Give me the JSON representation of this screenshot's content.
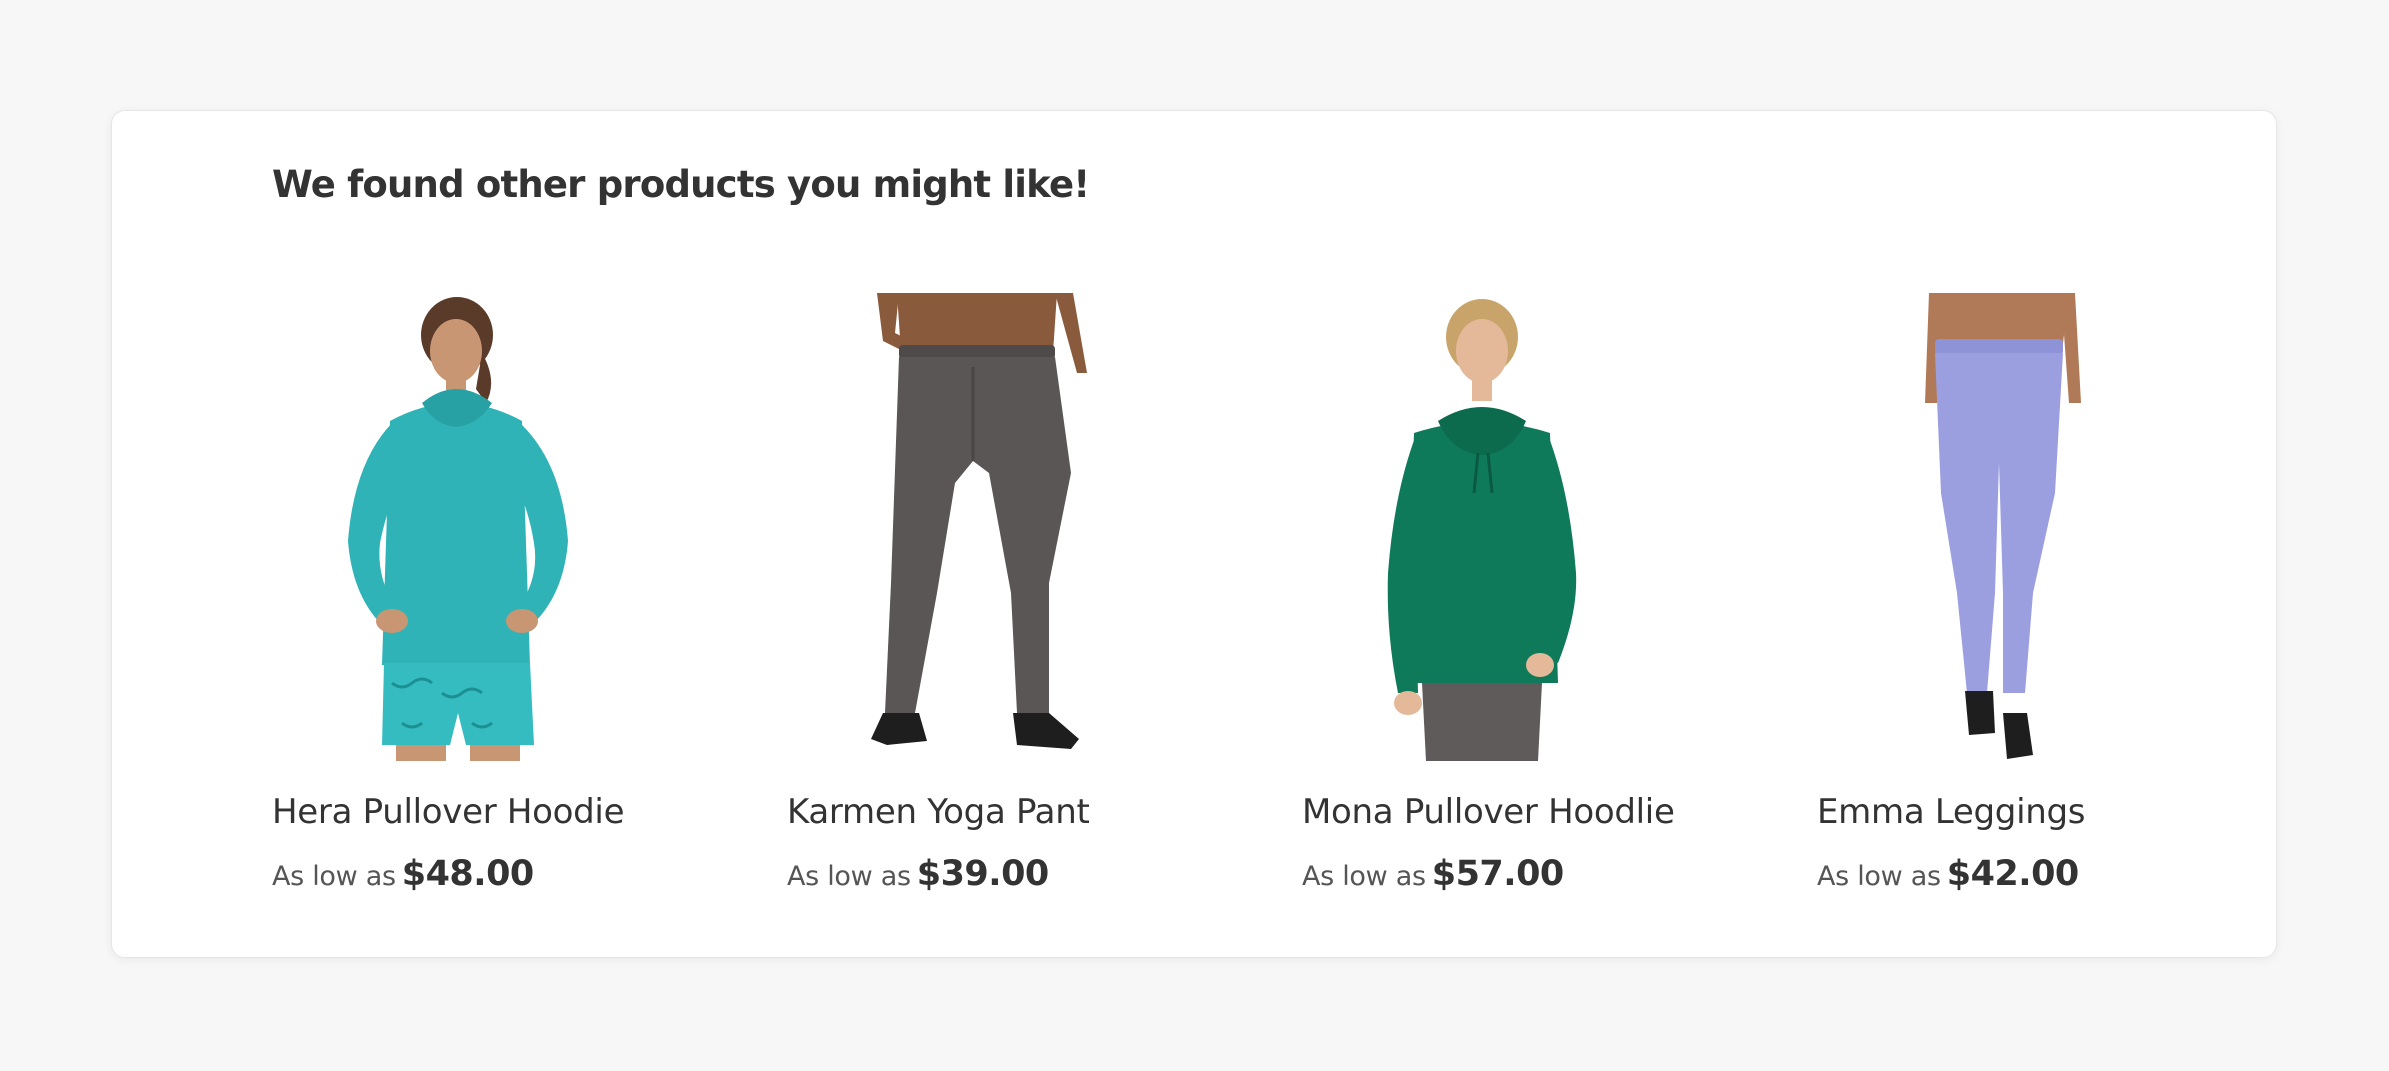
{
  "section": {
    "heading": "We found other products you might like!"
  },
  "products": [
    {
      "name": "Hera Pullover Hoodie",
      "price_prefix": "As low as",
      "price": "$48.00",
      "image_icon": "teal-hoodie-model-photo",
      "garment_color": "#2fb3b6"
    },
    {
      "name": "Karmen Yoga Pant",
      "price_prefix": "As low as",
      "price": "$39.00",
      "image_icon": "gray-yoga-pant-photo",
      "garment_color": "#5a5656"
    },
    {
      "name": "Mona Pullover Hoodlie",
      "price_prefix": "As low as",
      "price": "$57.00",
      "image_icon": "green-hoodie-model-photo",
      "garment_color": "#0f7a5a"
    },
    {
      "name": "Emma Leggings",
      "price_prefix": "As low as",
      "price": "$42.00",
      "image_icon": "lavender-leggings-photo",
      "garment_color": "#9b9fe0"
    }
  ]
}
